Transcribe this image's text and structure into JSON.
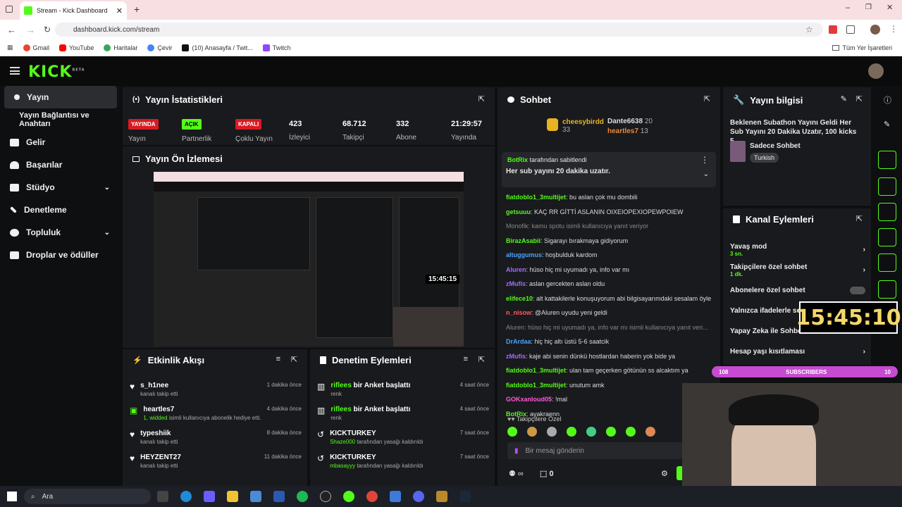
{
  "browser": {
    "tab_title": "Stream - Kick Dashboard",
    "url": "dashboard.kick.com/stream",
    "bookmarks": [
      "Gmail",
      "YouTube",
      "Haritalar",
      "Çevir",
      "(10) Anasayfa / Twit...",
      "Twitch"
    ],
    "all_bookmarks": "Tüm Yer İşaretleri"
  },
  "header": {
    "logo": "KICK",
    "beta": "BETA"
  },
  "sidebar": {
    "items": [
      {
        "label": "Yayın",
        "active": true
      },
      {
        "label": "Yayın Bağlantısı ve Anahtarı"
      },
      {
        "label": "Gelir"
      },
      {
        "label": "Başarılar"
      },
      {
        "label": "Stüdyo"
      },
      {
        "label": "Denetleme"
      },
      {
        "label": "Topluluk"
      },
      {
        "label": "Droplar ve ödüller"
      }
    ]
  },
  "stats": {
    "title": "Yayın İstatistikleri",
    "items": [
      {
        "badge": "YAYINDA",
        "label": "Yayın",
        "color": "#d91a22"
      },
      {
        "badge": "AÇIK",
        "label": "Partnerlik",
        "color": "#53fc18"
      },
      {
        "badge": "KAPALI",
        "label": "Çoklu Yayın",
        "color": "#d91a22"
      },
      {
        "value": "423",
        "label": "İzleyici"
      },
      {
        "value": "68.712",
        "label": "Takipçi"
      },
      {
        "value": "332",
        "label": "Abone"
      },
      {
        "value": "21:29:57",
        "label": "Yayında"
      }
    ]
  },
  "preview": {
    "title": "Yayın Ön İzlemesi",
    "timer": "15:45:15"
  },
  "activity": {
    "title": "Etkinlik Akışı",
    "items": [
      {
        "name": "s_h1nee",
        "sub": "kanalı takip etti",
        "time": "1 dakika önce"
      },
      {
        "name": "heartles7",
        "sub_green": "1, widded",
        "sub": "isimli kullanıcıya abonelik hediye etti.",
        "time": "4 dakika önce"
      },
      {
        "name": "typeshiik",
        "sub": "kanalı takip etti",
        "time": "8 dakika önce"
      },
      {
        "name": "HEYZENT27",
        "sub": "kanalı takip etti",
        "time": "11 dakika önce"
      }
    ]
  },
  "moderation": {
    "title": "Denetim Eylemleri",
    "items": [
      {
        "name": "riflees",
        "action": "bir Anket başlattı",
        "sub": "renk",
        "time": "4 saat önce"
      },
      {
        "name": "riflees",
        "action": "bir Anket başlattı",
        "sub": "renk",
        "time": "4 saat önce"
      },
      {
        "name": "KICKTURKEY",
        "sub_green": "Shaze000",
        "sub": "tarafından yasağı kaldırıldı",
        "time": "7 saat önce"
      },
      {
        "name": "KICKTURKEY",
        "sub_green": "mbasayyy",
        "sub": "tarafından yasağı kaldırıldı",
        "time": "7 saat önce"
      }
    ]
  },
  "chat": {
    "title": "Sohbet",
    "top_gifter": {
      "name": "cheesybirdd",
      "count": "33"
    },
    "gifters": [
      {
        "name": "Dante6638",
        "count": "20"
      },
      {
        "name": "heartles7",
        "count": "13"
      }
    ],
    "pinned": {
      "by": "BotRix",
      "by_label": "tarafından sabitlendi",
      "text": "Her sub yayını 20 dakika uzatır."
    },
    "messages": [
      {
        "user": "fiatdoblo1_3multijet",
        "text": "bu aslan çok mu dombili",
        "color": "#53fc18"
      },
      {
        "user": "getsuuu",
        "text": "KAÇ RR GİTTİ ASLANIN OIXEIOPEXIOPEWPOIEW",
        "color": "#53fc18"
      },
      {
        "user": "",
        "text": "Monofik: kamu spotu isimli kullanıcıya yanıt veriyor",
        "color": "#888"
      },
      {
        "user": "BirazAsabii",
        "text": "Sigarayı bırakmaya gidiyorum",
        "color": "#53fc18"
      },
      {
        "user": "altuggumus",
        "text": "hoşbulduk kardom",
        "color": "#4aa3ff"
      },
      {
        "user": "Aluren",
        "text": "hüso hiç mi uyumadı ya, info var mı",
        "color": "#a46bff"
      },
      {
        "user": "zMufis",
        "text": "aslan gercekten aslan oldu",
        "color": "#a46bff"
      },
      {
        "user": "elifece10",
        "text": "alt kattakilerle konuşuyorum abi bilgisayarımdaki sesalam öyle",
        "color": "#53fc18"
      },
      {
        "user": "n_nisow",
        "text": "@Aluren uyudu yeni geldi",
        "color": "#ff5a5a"
      },
      {
        "user": "",
        "text": "Aluren: hüso hiç mi uyumadı ya, info var mı isimli kullanıcıya yanıt veri...",
        "color": "#888"
      },
      {
        "user": "DrArdaa",
        "text": "hiç hiç altı üstü 5-6 saatcik",
        "color": "#4aa3ff"
      },
      {
        "user": "zMufis",
        "text": "kaje abi senin dünkü hostlardan haberin yok bide ya",
        "color": "#a46bff"
      },
      {
        "user": "fiatdoblo1_3multijet",
        "text": "ulan tam geçerken götünün ss alcaktım ya",
        "color": "#53fc18"
      },
      {
        "user": "fiatdoblo1_3multijet",
        "text": "unutum amk",
        "color": "#53fc18"
      },
      {
        "user": "GOKxanloud05",
        "text": "!mal",
        "color": "#ff5ad6"
      },
      {
        "user": "BotRix",
        "text": "ayakraenn",
        "color": "#53fc18"
      }
    ],
    "followers_only": "Takipçilere Özel",
    "input_placeholder": "Bir mesaj gönderin",
    "points": "0"
  },
  "stream_info": {
    "title": "Yayın bilgisi",
    "stream_title": "Beklenen Subathon Yayını Geldi Her Sub Yayını 20 Dakika Uzatır, 100 kicks 5...",
    "category": "Sadece Sohbet",
    "tag": "Turkish"
  },
  "channel_actions": {
    "title": "Kanal Eylemleri",
    "items": [
      {
        "label": "Yavaş mod",
        "sub": "3 sn."
      },
      {
        "label": "Takipçilere özel sohbet",
        "sub": "1 dk."
      },
      {
        "label": "Abonelere özel sohbet",
        "sub": ""
      },
      {
        "label": "Yalnızca ifadelerle sohbet",
        "sub": ""
      },
      {
        "label": "Yapay Zeka ile Sohbet",
        "sub": ""
      },
      {
        "label": "Hesap yaşı kısıtlaması",
        "sub": ""
      }
    ]
  },
  "overlay": {
    "timer": "15:45:10",
    "sub_left": "108",
    "sub_label": "SUBSCRIBERS",
    "sub_right": "10"
  },
  "taskbar": {
    "search": "Ara"
  },
  "colors": {
    "accent": "#53fc18",
    "panel": "#191a1d",
    "bg": "#0e0f11",
    "live": "#d91a22"
  }
}
